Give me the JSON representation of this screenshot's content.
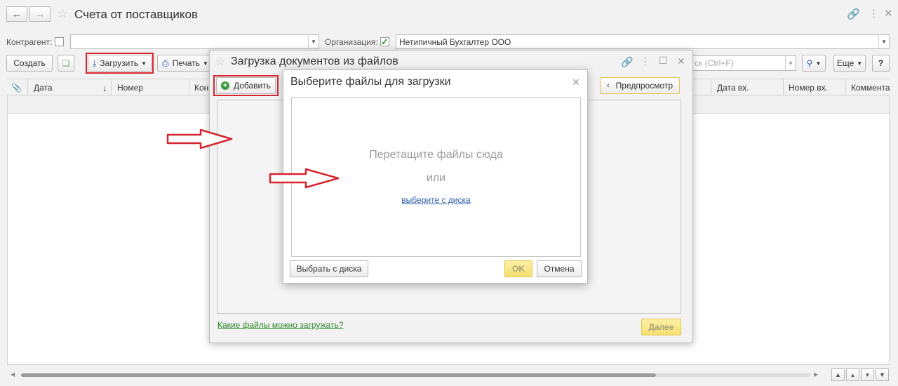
{
  "window": {
    "title": "Счета от поставщиков"
  },
  "filters": {
    "counterparty_label": "Контрагент:",
    "counterparty_checked": false,
    "counterparty_value": "",
    "organization_label": "Организация:",
    "organization_checked": true,
    "organization_value": "Нетипичный Бухгалтер ООО"
  },
  "toolbar": {
    "create_label": "Создать",
    "upload_label": "Загрузить",
    "print_label": "Печать",
    "search_placeholder": "ск (Ctrl+F)",
    "more_label": "Еще",
    "help_label": "?"
  },
  "grid": {
    "columns": [
      "Дата",
      "Номер",
      "Кон",
      "Дата вх.",
      "Номер вх.",
      "Коммента"
    ]
  },
  "load_dialog": {
    "title": "Загрузка документов из файлов",
    "add_label": "Добавить",
    "preview_label": "Предпросмотр",
    "help_link": "Какие файлы можно загружать?",
    "next_label": "Далее"
  },
  "select_dialog": {
    "title": "Выберите файлы для загрузки",
    "drop_text": "Перетащите файлы сюда",
    "or_text": "или",
    "choose_link": "выберите с диска",
    "choose_button": "Выбрать с диска",
    "ok_label": "OK",
    "cancel_label": "Отмена"
  },
  "colors": {
    "highlight": "#d6252f",
    "accent_green": "#3c9a3c",
    "primary_yellow": "#f4df70"
  }
}
